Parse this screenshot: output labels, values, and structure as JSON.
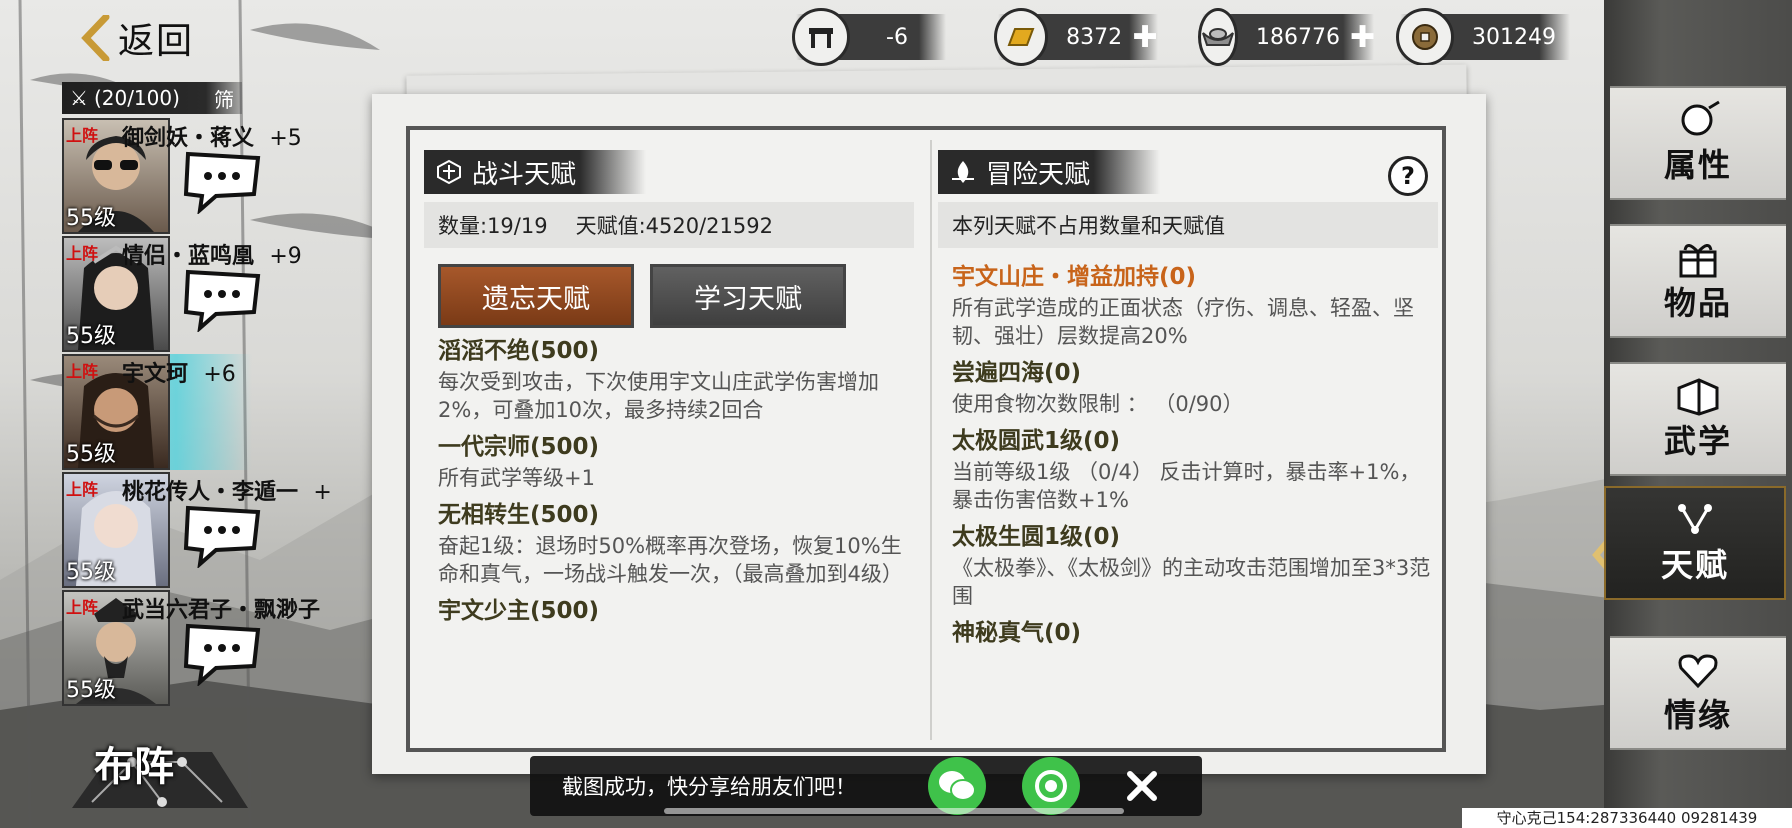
{
  "header": {
    "back_label": "返回",
    "resources": [
      {
        "icon": "stamina-icon",
        "value": "-6",
        "has_plus": false
      },
      {
        "icon": "gold-bar-icon",
        "value": "8372",
        "has_plus": true
      },
      {
        "icon": "silver-ingot-icon",
        "value": "186776",
        "has_plus": true
      },
      {
        "icon": "copper-coin-icon",
        "value": "301249",
        "has_plus": false
      }
    ]
  },
  "team": {
    "count_label": "(20/100)",
    "filter_label": "筛",
    "heroes": [
      {
        "tag": "上阵",
        "name": "御剑妖・蒋义",
        "bonus": "+5",
        "level": "55级"
      },
      {
        "tag": "上阵",
        "name": "情侣・蓝鸣凰",
        "bonus": "+9",
        "level": "55级"
      },
      {
        "tag": "上阵",
        "name": "宇文珂",
        "bonus": "+6",
        "level": "55级"
      },
      {
        "tag": "上阵",
        "name": "桃花传人・李遁一",
        "bonus": "+",
        "level": "55级"
      },
      {
        "tag": "上阵",
        "name": "武当六君子・飘渺子",
        "bonus": "",
        "level": "55级"
      }
    ],
    "formation_label": "布阵"
  },
  "combat": {
    "title": "战斗天赋",
    "count_label": "数量:19/19",
    "value_label": "天赋值:4520/21592",
    "forget_button": "遗忘天赋",
    "learn_button": "学习天赋",
    "talents": [
      {
        "name": "滔滔不绝(500)",
        "desc": "每次受到攻击，下次使用宇文山庄武学伤害增加2%，可叠加10次，最多持续2回合"
      },
      {
        "name": "一代宗师(500)",
        "desc": "所有武学等级+1"
      },
      {
        "name": "无相转生(500)",
        "desc": "奋起1级：退场时50%概率再次登场，恢复10%生命和真气，一场战斗触发一次，（最高叠加到4级）"
      },
      {
        "name": "宇文少主(500)",
        "desc": ""
      }
    ]
  },
  "adventure": {
    "title": "冒险天赋",
    "help_label": "?",
    "note": "本列天赋不占用数量和天赋值",
    "talents": [
      {
        "name": "宇文山庄・增益加持(0)",
        "desc": "所有武学造成的正面状态（疗伤、调息、轻盈、坚韧、强壮）层数提高20%",
        "highlight": true
      },
      {
        "name": "尝遍四海(0)",
        "desc": "使用食物次数限制 ： （0/90）",
        "highlight": false
      },
      {
        "name": "太极圆武1级(0)",
        "desc": "当前等级1级 （0/4） 反击计算时，暴击率+1%，暴击伤害倍数+1%",
        "highlight": false
      },
      {
        "name": "太极生圆1级(0)",
        "desc": "《太极拳》、《太极剑》的主动攻击范围增加至3*3范围",
        "highlight": false
      },
      {
        "name": "神秘真气(0)",
        "desc": "",
        "highlight": false
      }
    ]
  },
  "nav": {
    "items": [
      {
        "label": "属性",
        "icon": "attributes-icon"
      },
      {
        "label": "物品",
        "icon": "gift-box-icon"
      },
      {
        "label": "武学",
        "icon": "martial-book-icon"
      },
      {
        "label": "天赋",
        "icon": "talent-tree-icon"
      },
      {
        "label": "情缘",
        "icon": "heart-icon"
      }
    ],
    "active_index": 3
  },
  "toast": {
    "message": "截图成功，快分享给朋友们吧！"
  },
  "watermark": "守心克己154:287336440 09281439"
}
